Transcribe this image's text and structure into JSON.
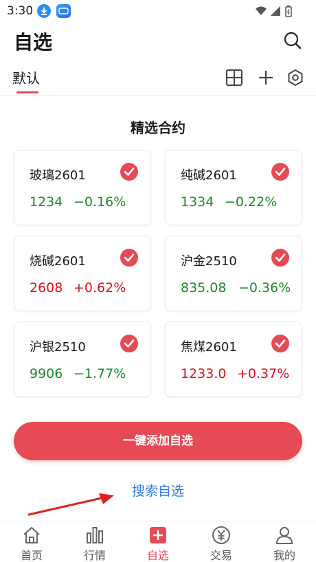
{
  "status_bar": {
    "time": "3:30"
  },
  "header": {
    "title": "自选"
  },
  "tabs": {
    "active_label": "默认"
  },
  "section": {
    "title": "精选合约"
  },
  "contracts": [
    {
      "name": "玻璃2601",
      "price": "1234",
      "change": "−0.16%",
      "direction": "down"
    },
    {
      "name": "纯碱2601",
      "price": "1334",
      "change": "−0.22%",
      "direction": "down"
    },
    {
      "name": "烧碱2601",
      "price": "2608",
      "change": "+0.62%",
      "direction": "up"
    },
    {
      "name": "沪金2510",
      "price": "835.08",
      "change": "−0.36%",
      "direction": "down"
    },
    {
      "name": "沪银2510",
      "price": "9906",
      "change": "−1.77%",
      "direction": "down"
    },
    {
      "name": "焦煤2601",
      "price": "1233.0",
      "change": "+0.37%",
      "direction": "up"
    }
  ],
  "actions": {
    "add_all_label": "一键添加自选",
    "search_label": "搜索自选"
  },
  "bottom_nav": [
    {
      "label": "首页",
      "icon": "home-icon"
    },
    {
      "label": "行情",
      "icon": "bar-chart-icon"
    },
    {
      "label": "自选",
      "icon": "plus-square-icon"
    },
    {
      "label": "交易",
      "icon": "yuan-coin-icon"
    },
    {
      "label": "我的",
      "icon": "user-icon"
    }
  ],
  "colors": {
    "accent": "#e64a55",
    "up": "#e0101a",
    "down": "#1a8a2a",
    "link": "#2f7de1"
  }
}
